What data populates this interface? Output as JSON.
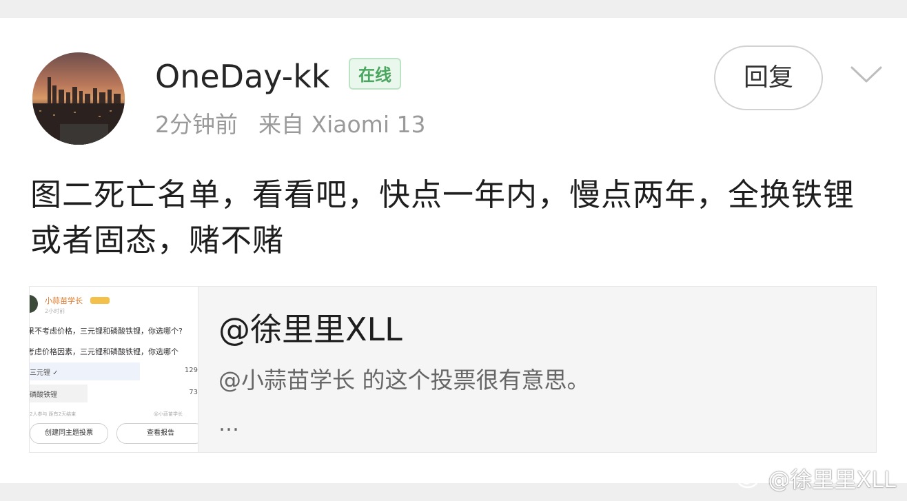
{
  "post": {
    "username": "OneDay-kk",
    "online_badge": "在线",
    "time": "2分钟前",
    "source": "来自 Xiaomi 13",
    "reply_label": "回复",
    "text": "图二死亡名单，看看吧，快点一年内，慢点两年，全换铁锂或者固态，赌不赌"
  },
  "repost": {
    "title": "@徐里里XLL",
    "body": "@小蒜苗学长 的这个投票很有意思。",
    "ellipsis": "…",
    "thumbnail": {
      "author": "小蒜苗学长",
      "time": "2小时前",
      "line1": "果不考虑价格，三元锂和磷酸铁锂，你选哪个?",
      "line2": "考虑价格因素，三元锂和磷酸铁锂，你选哪个",
      "option1": "三元锂 ✓",
      "option1_count": "129",
      "option2": "磷酸铁锂",
      "option2_count": "73",
      "footer_left": "2人参与  距有2天结束",
      "footer_right": "@小蒜苗学长",
      "button1": "创建同主题投票",
      "button2": "查看报告"
    }
  },
  "watermark": "@徐里里XLL",
  "icons": {
    "chevron": "chevron-down-icon",
    "weibo": "weibo-logo-icon"
  },
  "colors": {
    "online_green": "#4aa55e",
    "text_primary": "#1e1e1e",
    "text_secondary": "#9a9a9a"
  }
}
